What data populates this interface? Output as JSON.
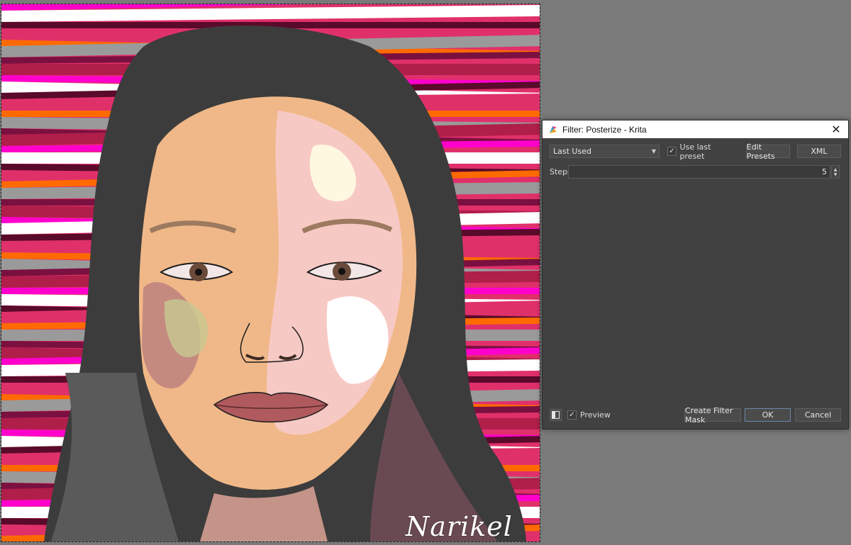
{
  "artwork": {
    "signature": "Narikel",
    "colors": {
      "stripe_palette": [
        "#ff00cc",
        "#e0306a",
        "#7a1040",
        "#ffffff",
        "#ff6a00",
        "#b01e4a",
        "#5a0a2a",
        "#9a9a9a"
      ],
      "hair": "#3c3c3c",
      "skin_light": "#f7c9c4",
      "skin_mid": "#f0b888",
      "skin_shadow": "#c48a80",
      "highlight": "#fff8e0",
      "lips": "#b05a5e"
    }
  },
  "dialog": {
    "title": "Filter: Posterize - Krita",
    "close_glyph": "✕",
    "preset_combo": {
      "value": "Last Used"
    },
    "use_last_preset": {
      "checked": true,
      "label": "Use last preset"
    },
    "edit_presets_label": "Edit Presets",
    "xml_label": "XML",
    "steps": {
      "label": "Steps:",
      "value": "5"
    },
    "preview": {
      "checked": true,
      "label": "Preview"
    },
    "create_filter_mask_label": "Create Filter Mask",
    "ok_label": "OK",
    "cancel_label": "Cancel",
    "colors": {
      "panel": "#414141",
      "titlebar": "#ffffff",
      "default_button_border": "#6b87a8"
    },
    "icons": [
      "krita-logo-icon",
      "close-icon",
      "dropdown-arrow-icon",
      "checkmark-icon",
      "spin-arrows-icon",
      "toggle-panel-icon"
    ]
  }
}
